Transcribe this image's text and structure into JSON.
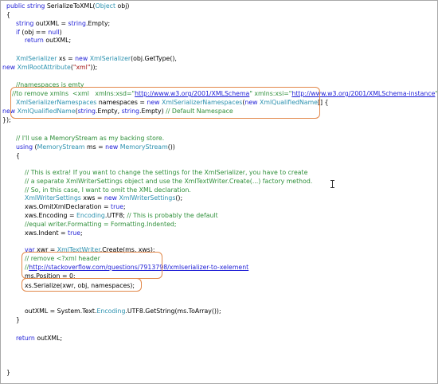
{
  "code": {
    "l1": {
      "kw1": "public",
      "kw2": "string",
      "rest": " SerializeToXML(",
      "ty": "Object",
      "tail": " obj)"
    },
    "l2": "{",
    "l3": {
      "kw": "string",
      "rest": " outXML = ",
      "kw2": "string",
      "tail": ".Empty;"
    },
    "l4": {
      "kw": "if",
      "rest": " (obj == ",
      "kw2": "null",
      "tail": ")"
    },
    "l5": {
      "kw": "return",
      "tail": " outXML;"
    },
    "l6": {
      "ty1": "XmlSerializer",
      "mid": " xs = ",
      "kw": "new",
      "ty2": " XmlSerializer",
      "tail": "(obj.GetType(),"
    },
    "l7": {
      "kw": "new",
      "ty": " XmlRootAttribute",
      "open": "(",
      "st": "\"xml\"",
      "tail": "));"
    },
    "l8": "//namespaces is emty",
    "l9": {
      "cm": "//to remove xmlns  <xml   xmlns:xsd=\"",
      "url1": "http://www.w3.org/2001/XMLSchema",
      "cm2": "\" xmlns:xsi=\"",
      "url2": "http://www.w3.org/2001/XMLSchema-instance",
      "cm3": "\">"
    },
    "l10": {
      "ty1": "XmlSerializerNamespaces",
      "mid": " namespaces = ",
      "kw": "new",
      "ty2": " XmlSerializerNamespaces",
      "mid2": "(",
      "kw2": "new",
      "ty3": " XmlQualifiedName",
      "tail": "[] {"
    },
    "l11": {
      "kw": "new",
      "ty": " XmlQualifiedName",
      "mid": "(",
      "kw2": "string",
      "mid2": ".Empty, ",
      "kw3": "string",
      "mid3": ".Empty) ",
      "cm": "// Default Namespace"
    },
    "l12": "});",
    "l13": "// I'll use a MemoryStream as my backing store.",
    "l14": {
      "kw": "using",
      "mid": " (",
      "ty": "MemoryStream",
      "mid2": " ms = ",
      "kw2": "new",
      "ty2": " MemoryStream",
      "tail": "())"
    },
    "l15": "{",
    "l16": "// This is extra! If you want to change the settings for the XmlSerializer, you have to create",
    "l17": "// a separate XmlWriterSettings object and use the XmlTextWriter.Create(...) factory method.",
    "l18": "// So, in this case, I want to omit the XML declaration.",
    "l19": {
      "ty": "XmlWriterSettings",
      "mid": " xws = ",
      "kw": "new",
      "ty2": " XmlWriterSettings",
      "tail": "();"
    },
    "l20": {
      "mid": "xws.OmitXmlDeclaration = ",
      "kw": "true",
      "tail": ";"
    },
    "l21": {
      "mid": "xws.Encoding = ",
      "ty": "Encoding",
      "mid2": ".UTF8; ",
      "cm": "// This is probably the default"
    },
    "l22": "//equal writer.Formatting = Formatting.Indented;",
    "l23": {
      "mid": "xws.Indent = ",
      "kw": "true",
      "tail": ";"
    },
    "l24": {
      "kw": "var",
      "mid": " xwr = ",
      "ty": "XmlTextWriter",
      "tail": ".Create(ms, xws);"
    },
    "l25": "// remove <?xml header",
    "l26": {
      "cm": "//",
      "url": "http://stackoverflow.com/questions/7913798/xmlserializer-to-xelement"
    },
    "l27": "ms.Position = 0;",
    "l28": "xs.Serialize(xwr, obj, namespaces);",
    "l29": {
      "mid": "outXML = System.Text.",
      "ty": "Encoding",
      "tail": ".UTF8.GetString(ms.ToArray());"
    },
    "l30": "}",
    "l31": {
      "kw": "return",
      "tail": " outXML;"
    },
    "l32": "}"
  },
  "colors": {
    "keyword": "#1d1dd6",
    "type": "#2b91af",
    "comment": "#2f8f3a",
    "string": "#a31515",
    "highlight_border": "#e2884a"
  }
}
